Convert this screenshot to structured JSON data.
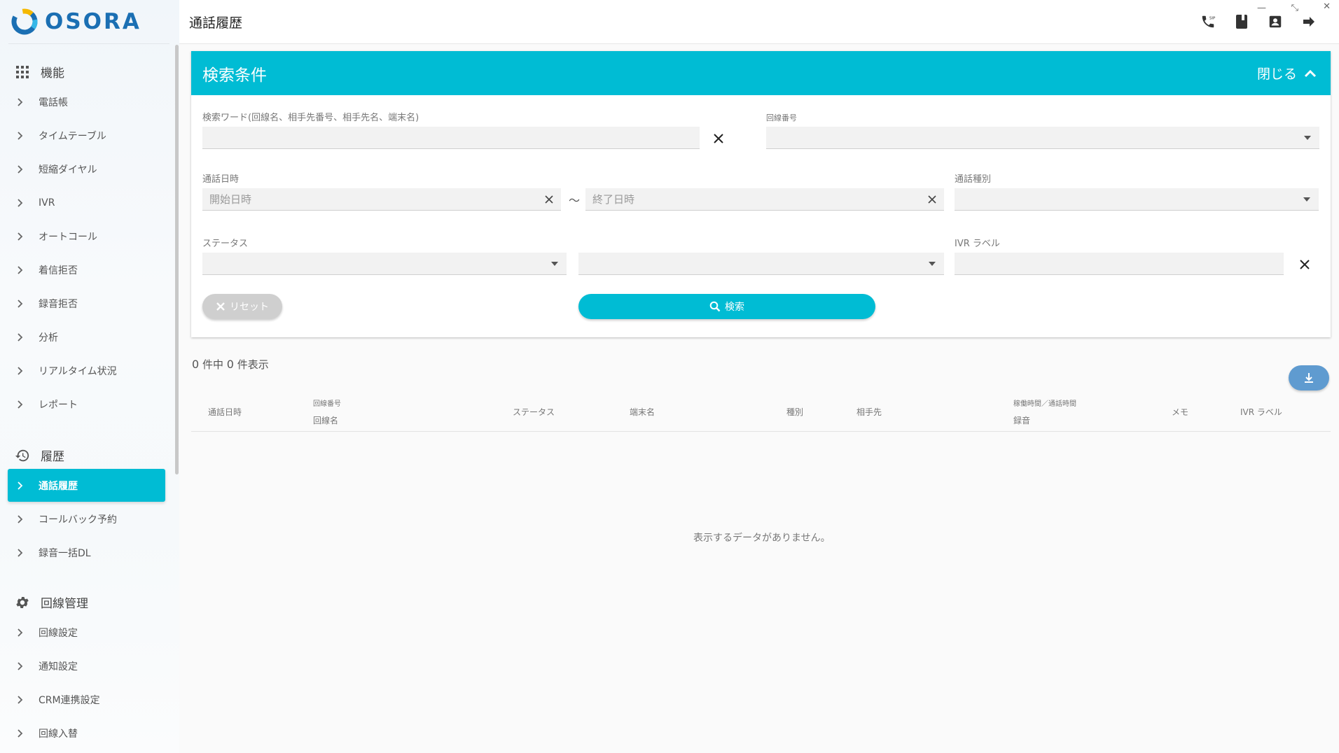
{
  "app": {
    "logo_text": "OSORA",
    "page_title": "通話履歴"
  },
  "sidebar": {
    "sections": [
      {
        "title": "機能",
        "icon": "grid-icon"
      },
      {
        "title": "履歴",
        "icon": "history-icon"
      },
      {
        "title": "回線管理",
        "icon": "gear-icon"
      }
    ],
    "features": [
      "電話帳",
      "タイムテーブル",
      "短縮ダイヤル",
      "IVR",
      "オートコール",
      "着信拒否",
      "録音拒否",
      "分析",
      "リアルタイム状況",
      "レポート"
    ],
    "history": [
      "通話履歴",
      "コールバック予約",
      "録音一括DL"
    ],
    "line_mgmt": [
      "回線設定",
      "通知設定",
      "CRM連携設定",
      "回線入替"
    ],
    "active_item": "通話履歴"
  },
  "topbar": {
    "icons": [
      "sip-phone-icon",
      "phonebook-icon",
      "contact-icon",
      "logout-icon"
    ],
    "window_controls": [
      "minimize",
      "restore",
      "close"
    ]
  },
  "search_panel": {
    "title": "検索条件",
    "close_label": "閉じる",
    "keyword_label": "検索ワード(回線名、相手先番号、相手先名、端末名)",
    "keyword_value": "",
    "line_number_label": "回線番号",
    "call_datetime_label": "通話日時",
    "start_placeholder": "開始日時",
    "end_placeholder": "終了日時",
    "range_sep": "～",
    "call_type_label": "通話種別",
    "status_label": "ステータス",
    "ivr_label": "IVR ラベル",
    "reset_label": "リセット",
    "search_label": "検索"
  },
  "results": {
    "count_total": "0",
    "count_shown": "0",
    "count_mid": "件中",
    "count_suffix": "件表示",
    "columns": {
      "call_datetime": "通話日時",
      "line_number": "回線番号",
      "line_name": "回線名",
      "status": "ステータス",
      "terminal": "端末名",
      "type": "種別",
      "partner": "相手先",
      "durations": "稼働時間／通話時間",
      "recording": "録音",
      "memo": "メモ",
      "ivr_label": "IVR ラベル"
    },
    "empty_message": "表示するデータがありません。"
  },
  "colors": {
    "accent": "#00bcd4",
    "download": "#5f9bd0",
    "logo": "#1b6fb3"
  }
}
